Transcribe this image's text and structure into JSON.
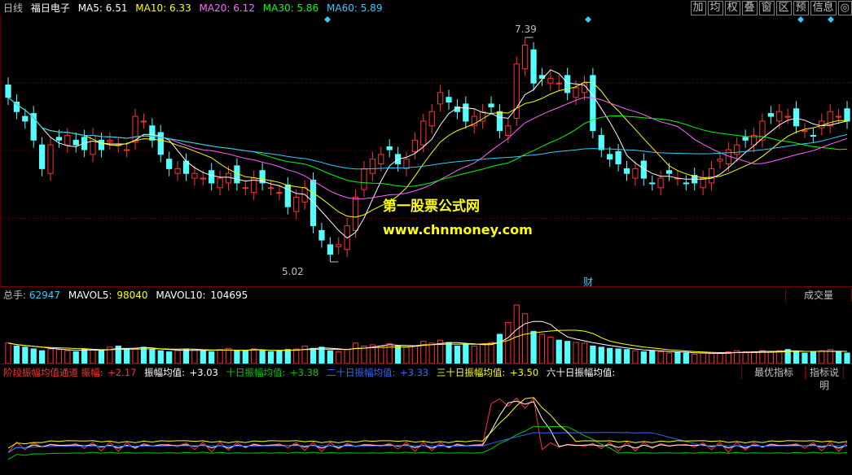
{
  "header": {
    "period": "日线",
    "stock_name": "福日电子",
    "ma": [
      {
        "label": "MA5: 6.51",
        "color": "#ffffff"
      },
      {
        "label": "MA10: 6.33",
        "color": "#ffff00"
      },
      {
        "label": "MA20: 6.12",
        "color": "#ff66ff"
      },
      {
        "label": "MA30: 5.86",
        "color": "#00ff00"
      },
      {
        "label": "MA60: 5.89",
        "color": "#33ccff"
      }
    ]
  },
  "toolbar": [
    "加",
    "均",
    "权",
    "叠",
    "窗",
    "区",
    "预",
    "信息",
    "◎"
  ],
  "price_chart": {
    "high_label": "7.39",
    "low_label": "5.02",
    "finance_marker": "财",
    "diamonds": 4,
    "watermark_cn": "第一股票公式网",
    "watermark_url": "www.chnmoney.com",
    "candles": [
      6.75,
      6.6,
      6.5,
      6.3,
      6.0,
      6.25,
      6.3,
      6.35,
      6.25,
      6.2,
      6.35,
      6.2,
      6.3,
      6.25,
      6.2,
      6.55,
      6.5,
      6.3,
      6.15,
      6.0,
      6.0,
      5.95,
      5.95,
      5.9,
      5.85,
      5.9,
      5.95,
      5.85,
      5.8,
      5.9,
      5.85,
      5.8,
      5.75,
      5.6,
      5.7,
      5.8,
      5.4,
      5.25,
      5.1,
      5.2,
      5.4,
      5.7,
      6.0,
      6.1,
      6.15,
      6.2,
      6.05,
      6.1,
      6.3,
      6.5,
      6.6,
      6.8,
      6.7,
      6.6,
      6.5,
      6.55,
      6.6,
      6.65,
      6.4,
      6.45,
      7.1,
      7.3,
      6.9,
      6.95,
      6.95,
      6.9,
      6.8,
      6.85,
      6.9,
      6.4,
      6.2,
      6.1,
      6.05,
      5.95,
      6.0,
      5.9,
      5.85,
      5.9,
      5.95,
      5.9,
      5.85,
      5.85,
      5.9,
      6.0,
      6.1,
      6.2,
      6.25,
      6.3,
      6.35,
      6.5,
      6.55,
      6.6,
      6.55,
      6.45,
      6.4,
      6.35,
      6.5,
      6.6,
      6.55,
      6.5
    ]
  },
  "volume": {
    "total_label": "总手:",
    "total_value": "62947",
    "mavol5_label": "MAVOL5:",
    "mavol5_value": "98040",
    "mavol10_label": "MAVOL10:",
    "mavol10_value": "104695",
    "tab_label": "成交量",
    "bars": [
      0.35,
      0.3,
      0.28,
      0.25,
      0.22,
      0.25,
      0.24,
      0.22,
      0.2,
      0.25,
      0.24,
      0.22,
      0.28,
      0.3,
      0.25,
      0.26,
      0.28,
      0.24,
      0.22,
      0.2,
      0.22,
      0.25,
      0.24,
      0.22,
      0.2,
      0.24,
      0.26,
      0.22,
      0.22,
      0.25,
      0.23,
      0.2,
      0.22,
      0.24,
      0.25,
      0.3,
      0.26,
      0.28,
      0.22,
      0.2,
      0.24,
      0.35,
      0.3,
      0.32,
      0.3,
      0.34,
      0.3,
      0.28,
      0.3,
      0.38,
      0.35,
      0.4,
      0.36,
      0.3,
      0.32,
      0.3,
      0.34,
      0.36,
      0.5,
      0.7,
      1.0,
      0.85,
      0.55,
      0.5,
      0.45,
      0.4,
      0.38,
      0.36,
      0.35,
      0.3,
      0.28,
      0.26,
      0.25,
      0.24,
      0.22,
      0.2,
      0.22,
      0.2,
      0.18,
      0.2,
      0.18,
      0.16,
      0.18,
      0.17,
      0.18,
      0.2,
      0.22,
      0.2,
      0.2,
      0.22,
      0.2,
      0.22,
      0.24,
      0.2,
      0.18,
      0.2,
      0.22,
      0.24,
      0.2,
      0.18
    ]
  },
  "indicator": {
    "items": [
      {
        "label": "阶段振幅均值通道 振幅:",
        "value": "+2.17",
        "color": "#ff3333"
      },
      {
        "label": "振幅均值:",
        "value": "+3.03",
        "color": "#ffffff"
      },
      {
        "label": "十日振幅均值:",
        "value": "+3.38",
        "color": "#00cc00"
      },
      {
        "label": "二十日振幅均值:",
        "value": "+3.33",
        "color": "#3366ff"
      },
      {
        "label": "三十日振幅均值:",
        "value": "+3.50",
        "color": "#ffff00"
      },
      {
        "label": "六十日振幅均值:",
        "value": "",
        "color": "#ffffff"
      }
    ],
    "buttons": [
      "最优指标",
      "指标说明"
    ]
  }
}
